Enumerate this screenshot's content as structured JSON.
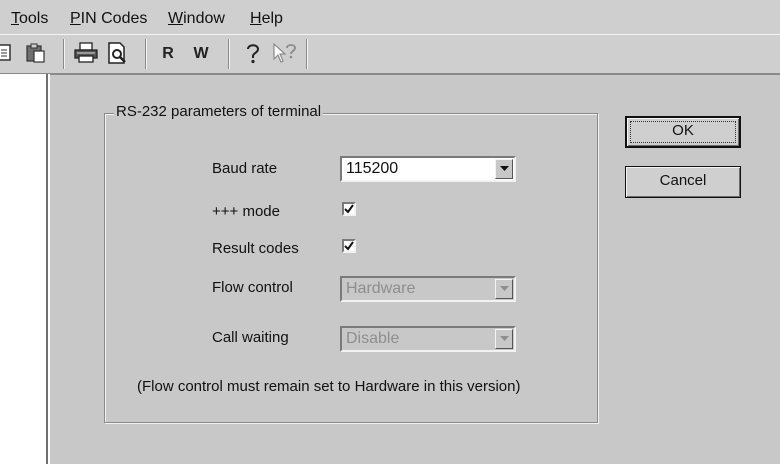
{
  "menu": {
    "items": [
      {
        "label": "Tools",
        "accel": "T",
        "rest": "ools"
      },
      {
        "label": "PIN Codes",
        "accel": "P",
        "rest": "IN Codes"
      },
      {
        "label": "Window",
        "accel": "W",
        "rest": "indow"
      },
      {
        "label": "Help",
        "accel": "H",
        "rest": "elp"
      }
    ]
  },
  "toolbar": {
    "icons": [
      "copy-icon",
      "paste-icon",
      "print-icon",
      "print-preview-icon",
      "read-icon",
      "write-icon",
      "help-icon",
      "context-help-icon"
    ],
    "read_label": "R",
    "write_label": "W"
  },
  "dialog": {
    "group_title": "RS-232 parameters of terminal",
    "fields": {
      "baud_rate": {
        "label": "Baud rate",
        "value": "115200"
      },
      "plus_mode": {
        "label": "+++ mode",
        "checked": true
      },
      "result_codes": {
        "label": "Result codes",
        "checked": true
      },
      "flow_control": {
        "label": "Flow control",
        "value": "Hardware",
        "disabled": true
      },
      "call_waiting": {
        "label": "Call waiting",
        "value": "Disable",
        "disabled": true
      }
    },
    "note": "(Flow control must remain set to Hardware in this version)",
    "buttons": {
      "ok": "OK",
      "cancel": "Cancel"
    }
  },
  "colors": {
    "dialog_bg": "#c8c8c8",
    "bar_bg": "#cfcfcf",
    "field_bg": "#ffffff",
    "disabled_text": "#8e8e8e"
  }
}
